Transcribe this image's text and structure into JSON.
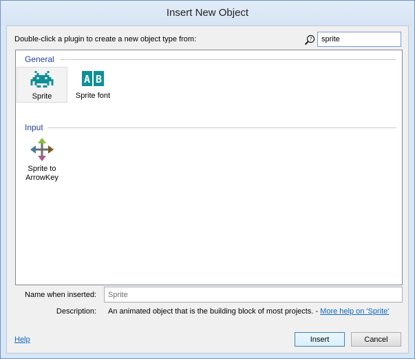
{
  "window": {
    "title": "Insert New Object"
  },
  "prompt": "Double-click a plugin to create a new object type from:",
  "search": {
    "value": "sprite",
    "icon": "search-icon"
  },
  "groups": [
    {
      "label": "General",
      "items": [
        {
          "label": "Sprite",
          "icon": "space-invader-icon",
          "selected": true
        },
        {
          "label": "Sprite font",
          "icon": "ab-letters-icon",
          "selected": false
        }
      ]
    },
    {
      "label": "Input",
      "items": [
        {
          "label_line1": "Sprite to",
          "label_line2": "ArrowKey",
          "icon": "four-arrows-icon",
          "selected": false
        }
      ]
    }
  ],
  "name_field": {
    "label": "Name when inserted:",
    "value": "Sprite"
  },
  "description": {
    "label": "Description:",
    "text": "An animated object that is the building block of most projects. - ",
    "link": "More help on 'Sprite'"
  },
  "footer": {
    "help": "Help",
    "insert": "Insert",
    "cancel": "Cancel"
  },
  "colors": {
    "accent": "#1e3e9f",
    "icon_teal": "#108f97",
    "link": "#0a66c2"
  }
}
